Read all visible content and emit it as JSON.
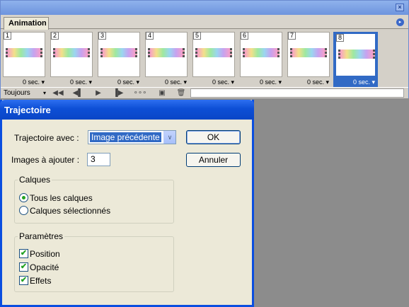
{
  "animation_panel": {
    "tab_label": "Animation",
    "close_glyph": "×",
    "menu_glyph": "▸",
    "frames": [
      {
        "number": "1",
        "delay": "0 sec."
      },
      {
        "number": "2",
        "delay": "0 sec."
      },
      {
        "number": "3",
        "delay": "0 sec."
      },
      {
        "number": "4",
        "delay": "0 sec."
      },
      {
        "number": "5",
        "delay": "0 sec."
      },
      {
        "number": "6",
        "delay": "0 sec."
      },
      {
        "number": "7",
        "delay": "0 sec."
      },
      {
        "number": "8",
        "delay": "0 sec.",
        "selected": true
      }
    ],
    "dropdown_glyph": "▾",
    "loop_option": "Toujours",
    "controls": {
      "first_frame": "◀◀",
      "previous_frame": "◀▌",
      "play": "▶",
      "next_frame": "▐▶",
      "tween": "∘∘∘",
      "duplicate": "▣",
      "delete": "🗑"
    }
  },
  "dialog": {
    "title": "Trajectoire",
    "tween_with_label": "Trajectoire avec :",
    "tween_with_value": "Image précédente",
    "combo_arrow": "∨",
    "frames_to_add_label": "Images à ajouter :",
    "frames_to_add_value": "3",
    "ok_label": "OK",
    "cancel_label": "Annuler",
    "layers_group": {
      "title": "Calques",
      "options": [
        "Tous les calques",
        "Calques sélectionnés"
      ],
      "selected": 0
    },
    "params_group": {
      "title": "Paramètres",
      "checkmark": "✔",
      "items": [
        {
          "label": "Position",
          "checked": true
        },
        {
          "label": "Opacité",
          "checked": true
        },
        {
          "label": "Effets",
          "checked": true
        }
      ]
    }
  },
  "colors": {
    "selection": "#316ac5",
    "dialog_title": "#0a46c7",
    "panel_bg": "#d4d0c8",
    "dialog_bg": "#ece9d8"
  }
}
